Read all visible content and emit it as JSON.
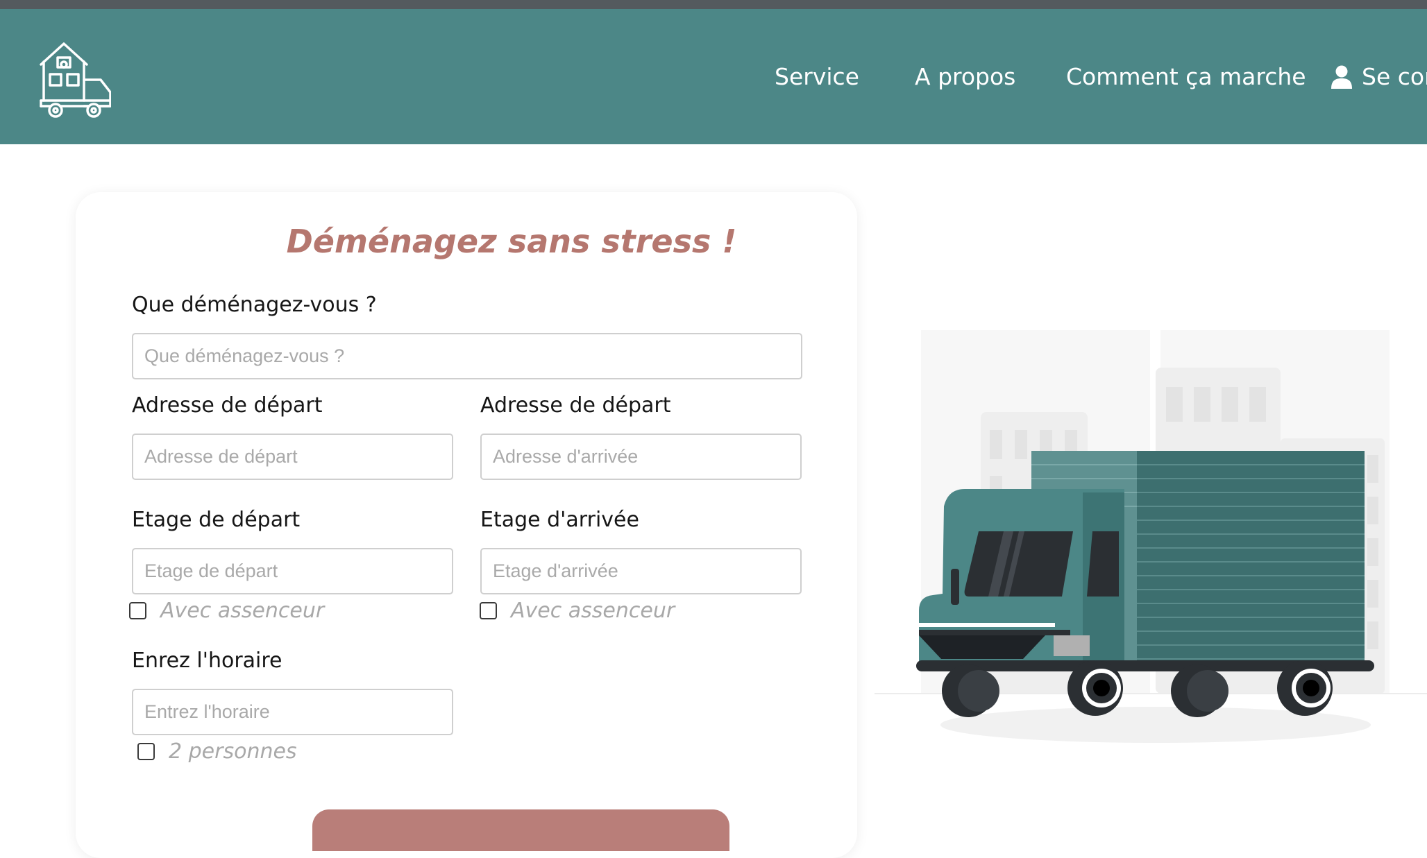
{
  "nav": {
    "items": [
      "Service",
      "A propos",
      "Comment ça marche"
    ],
    "login_label": "Se cor",
    "login_icon": "user-icon",
    "logo_icon": "house-truck-logo-icon",
    "bg_color": "#4c8787"
  },
  "form": {
    "title": "Déménagez sans stress !",
    "what": {
      "label": "Que déménagez-vous ?",
      "placeholder": "Que déménagez-vous ?"
    },
    "departure_address": {
      "label": "Adresse de départ",
      "placeholder": "Adresse de départ"
    },
    "arrival_address": {
      "label": "Adresse de départ",
      "placeholder": "Adresse d'arrivée"
    },
    "departure_floor": {
      "label": "Etage de départ",
      "placeholder": "Etage de départ",
      "checkbox_label": "Avec assenceur"
    },
    "arrival_floor": {
      "label": "Etage d'arrivée",
      "placeholder": "Etage d'arrivée",
      "checkbox_label": "Avec assenceur"
    },
    "schedule": {
      "label": "Enrez l'horaire",
      "placeholder": "Entrez l'horaire",
      "checkbox_label": "2 personnes"
    },
    "title_color": "#b5776f",
    "button_color": "#b97e79"
  },
  "illustration": {
    "icon": "moving-truck-illustration"
  }
}
